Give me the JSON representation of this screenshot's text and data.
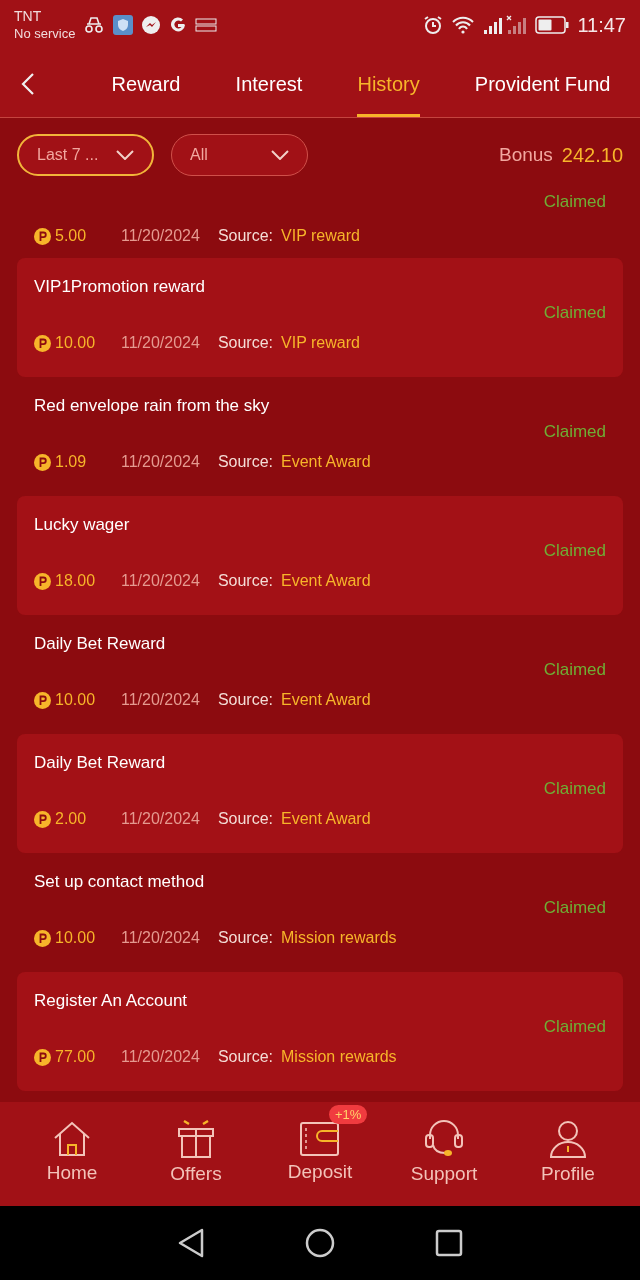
{
  "status_bar": {
    "carrier": "TNT",
    "service": "No service",
    "time": "11:47"
  },
  "tabs": [
    {
      "label": "Reward",
      "selected": false
    },
    {
      "label": "Interest",
      "selected": false
    },
    {
      "label": "History",
      "selected": true
    },
    {
      "label": "Provident Fund",
      "selected": false
    }
  ],
  "filters": [
    {
      "value": "Last 7 ...",
      "selected": true
    },
    {
      "value": "All",
      "selected": false
    }
  ],
  "bonus": {
    "label": "Bonus",
    "value": "242.10"
  },
  "partial_record": {
    "status": "Claimed",
    "amount": "5.00",
    "date": "11/20/2024",
    "source_label": "Source:",
    "source": "VIP reward"
  },
  "records": [
    {
      "title": "VIP1Promotion reward",
      "status": "Claimed",
      "amount": "10.00",
      "date": "11/20/2024",
      "source_label": "Source:",
      "source": "VIP reward"
    },
    {
      "title": "Red envelope rain from the sky",
      "status": "Claimed",
      "amount": "1.09",
      "date": "11/20/2024",
      "source_label": "Source:",
      "source": "Event Award"
    },
    {
      "title": "Lucky wager",
      "status": "Claimed",
      "amount": "18.00",
      "date": "11/20/2024",
      "source_label": "Source:",
      "source": "Event Award"
    },
    {
      "title": "Daily Bet Reward",
      "status": "Claimed",
      "amount": "10.00",
      "date": "11/20/2024",
      "source_label": "Source:",
      "source": "Event Award"
    },
    {
      "title": "Daily Bet Reward",
      "status": "Claimed",
      "amount": "2.00",
      "date": "11/20/2024",
      "source_label": "Source:",
      "source": "Event Award"
    },
    {
      "title": "Set up contact method",
      "status": "Claimed",
      "amount": "10.00",
      "date": "11/20/2024",
      "source_label": "Source:",
      "source": "Mission rewards"
    },
    {
      "title": "Register An Account",
      "status": "Claimed",
      "amount": "77.00",
      "date": "11/20/2024",
      "source_label": "Source:",
      "source": "Mission rewards"
    }
  ],
  "bottom_nav": [
    {
      "kind": "home",
      "label": "Home"
    },
    {
      "kind": "offers",
      "label": "Offers"
    },
    {
      "kind": "deposit",
      "label": "Deposit",
      "badge": "+1%"
    },
    {
      "kind": "support",
      "label": "Support"
    },
    {
      "kind": "profile",
      "label": "Profile"
    }
  ]
}
